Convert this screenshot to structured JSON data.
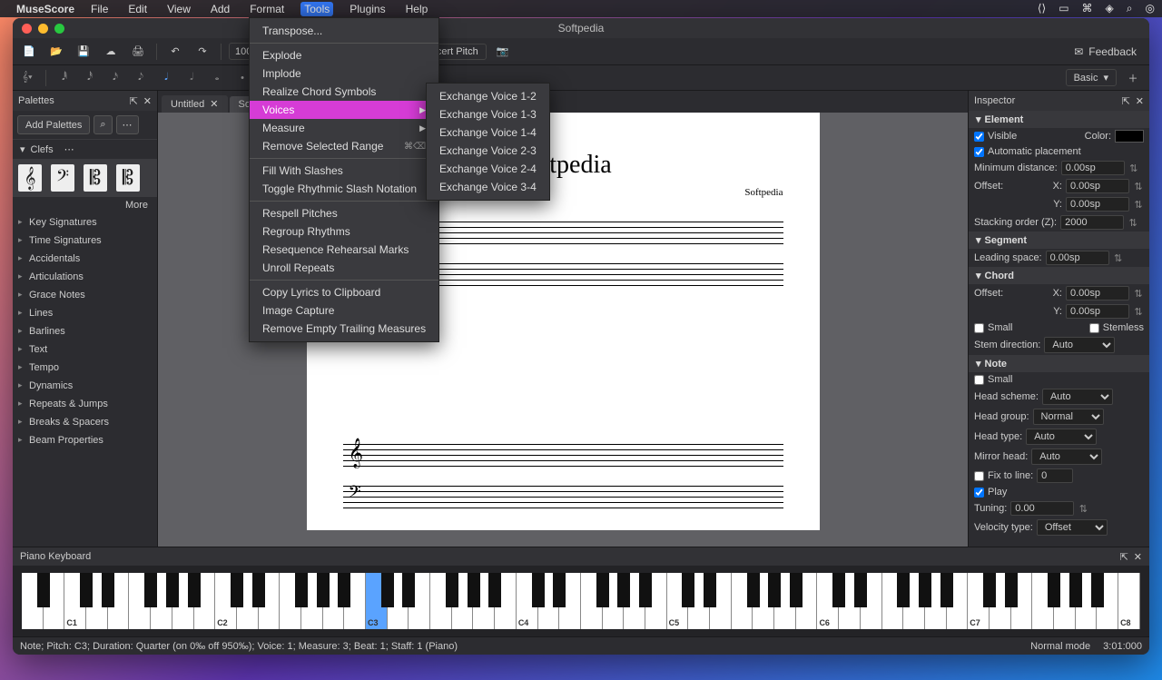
{
  "menubar": {
    "app": "MuseScore",
    "items": [
      "File",
      "Edit",
      "View",
      "Add",
      "Format",
      "Tools",
      "Plugins",
      "Help"
    ],
    "active_index": 5
  },
  "window": {
    "title": "Softpedia"
  },
  "toolbar": {
    "zoom": "100%",
    "concert_pitch": "Concert Pitch",
    "feedback": "Feedback"
  },
  "toolbar2": {
    "number_box": "4",
    "view_mode": "Basic"
  },
  "tools_menu": {
    "items": [
      {
        "label": "Transpose...",
        "sep_after": true
      },
      {
        "label": "Explode"
      },
      {
        "label": "Implode"
      },
      {
        "label": "Realize Chord Symbols"
      },
      {
        "label": "Voices",
        "submenu": true,
        "highlight": true
      },
      {
        "label": "Measure",
        "submenu": true
      },
      {
        "label": "Remove Selected Range",
        "shortcut": "⌘⌫",
        "sep_after": true
      },
      {
        "label": "Fill With Slashes"
      },
      {
        "label": "Toggle Rhythmic Slash Notation",
        "sep_after": true
      },
      {
        "label": "Respell Pitches"
      },
      {
        "label": "Regroup Rhythms"
      },
      {
        "label": "Resequence Rehearsal Marks"
      },
      {
        "label": "Unroll Repeats",
        "sep_after": true
      },
      {
        "label": "Copy Lyrics to Clipboard"
      },
      {
        "label": "Image Capture"
      },
      {
        "label": "Remove Empty Trailing Measures"
      }
    ]
  },
  "voices_submenu": [
    "Exchange Voice 1-2",
    "Exchange Voice 1-3",
    "Exchange Voice 1-4",
    "Exchange Voice 2-3",
    "Exchange Voice 2-4",
    "Exchange Voice 3-4"
  ],
  "palettes": {
    "title": "Palettes",
    "add_btn": "Add Palettes",
    "open_section": "Clefs",
    "more": "More",
    "sections": [
      "Key Signatures",
      "Time Signatures",
      "Accidentals",
      "Articulations",
      "Grace Notes",
      "Lines",
      "Barlines",
      "Text",
      "Tempo",
      "Dynamics",
      "Repeats & Jumps",
      "Breaks & Spacers",
      "Beam Properties"
    ]
  },
  "tabs": [
    {
      "label": "Untitled",
      "close": true
    },
    {
      "label": "Softpe",
      "active": true
    }
  ],
  "score": {
    "title": "Softpedia",
    "composer": "Softpedia"
  },
  "inspector": {
    "title": "Inspector",
    "element": {
      "header": "Element",
      "visible": "Visible",
      "color": "Color:",
      "auto_place": "Automatic placement",
      "min_dist_label": "Minimum distance:",
      "min_dist": "0.00sp",
      "offset": "Offset:",
      "x_label": "X:",
      "x": "0.00sp",
      "y_label": "Y:",
      "y": "0.00sp",
      "stacking_label": "Stacking order (Z):",
      "stacking": "2000"
    },
    "segment": {
      "header": "Segment",
      "leading_label": "Leading space:",
      "leading": "0.00sp"
    },
    "chord": {
      "header": "Chord",
      "offset": "Offset:",
      "x_label": "X:",
      "x": "0.00sp",
      "y_label": "Y:",
      "y": "0.00sp",
      "small": "Small",
      "stemless": "Stemless",
      "stem_dir_label": "Stem direction:",
      "stem_dir": "Auto"
    },
    "note": {
      "header": "Note",
      "small": "Small",
      "head_scheme_label": "Head scheme:",
      "head_scheme": "Auto",
      "head_group_label": "Head group:",
      "head_group": "Normal",
      "head_type_label": "Head type:",
      "head_type": "Auto",
      "mirror_label": "Mirror head:",
      "mirror": "Auto",
      "fix_line_label": "Fix to line:",
      "fix_line": "0",
      "play": "Play",
      "tuning_label": "Tuning:",
      "tuning": "0.00",
      "velocity_type_label": "Velocity type:",
      "velocity_type": "Offset"
    }
  },
  "piano": {
    "title": "Piano Keyboard",
    "labels": [
      "C1",
      "C2",
      "C3",
      "C4",
      "C5",
      "C6",
      "C7",
      "C8"
    ],
    "highlighted": "C3"
  },
  "statusbar": {
    "left": "Note; Pitch: C3; Duration: Quarter (on 0‰ off 950‰); Voice: 1;  Measure: 3; Beat: 1; Staff: 1 (Piano)",
    "mode": "Normal mode",
    "time": "3:01:000"
  }
}
